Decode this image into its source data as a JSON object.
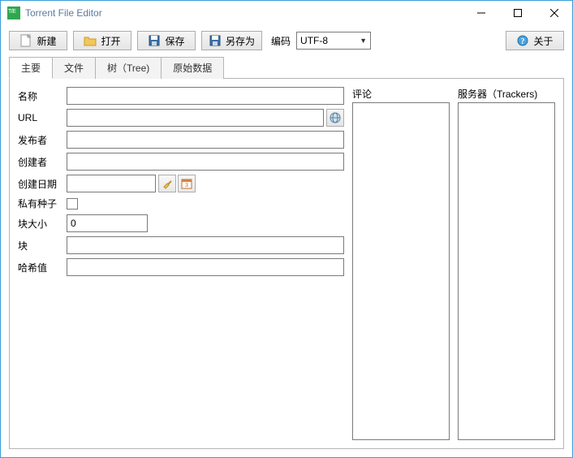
{
  "title": "Torrent File Editor",
  "toolbar": {
    "new": "新建",
    "open": "打开",
    "save": "保存",
    "saveas": "另存为",
    "encoding_label": "编码",
    "encoding_value": "UTF-8",
    "about": "关于"
  },
  "tabs": {
    "main": "主要",
    "files": "文件",
    "tree": "树（Tree)",
    "raw": "原始数据"
  },
  "form": {
    "name_label": "名称",
    "name_value": "",
    "url_label": "URL",
    "url_value": "",
    "publisher_label": "发布者",
    "publisher_value": "",
    "creator_label": "创建者",
    "creator_value": "",
    "created_label": "创建日期",
    "created_value": "",
    "private_label": "私有种子",
    "private_value": false,
    "piece_size_label": "块大小",
    "piece_size_value": "0",
    "pieces_label": "块",
    "pieces_value": "",
    "hash_label": "哈希值",
    "hash_value": ""
  },
  "side": {
    "comments": "评论",
    "trackers": "服务器（Trackers)"
  }
}
